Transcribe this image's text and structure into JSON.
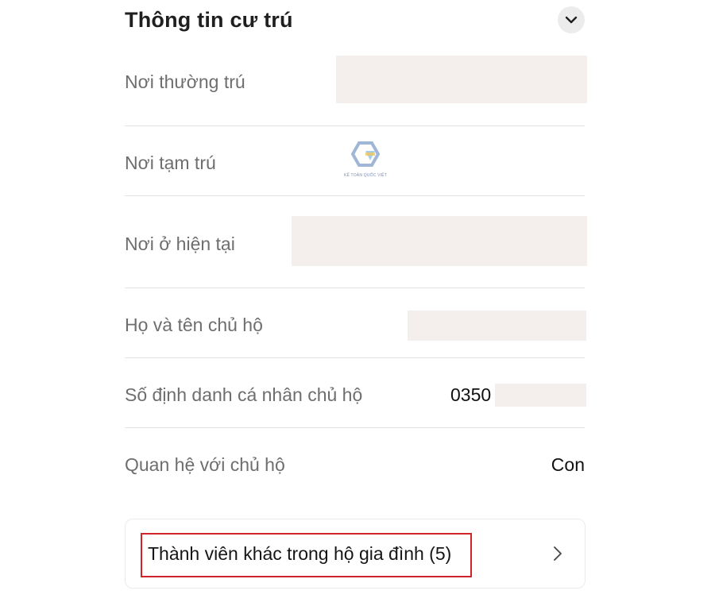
{
  "section": {
    "title": "Thông tin cư trú",
    "toggle_icon": "chevron-down-icon"
  },
  "fields": [
    {
      "label": "Nơi thường trú",
      "value": ""
    },
    {
      "label": "Nơi tạm trú",
      "value": ""
    },
    {
      "label": "Nơi ở hiện tại",
      "value": ""
    },
    {
      "label": "Họ và tên chủ hộ",
      "value": ""
    },
    {
      "label": "Số định danh cá nhân chủ hộ",
      "value": "0350"
    },
    {
      "label": "Quan hệ với chủ hộ",
      "value": "Con"
    }
  ],
  "watermark": {
    "text": "KẾ TOÁN QUỐC VIỆT"
  },
  "members_card": {
    "label": "Thành viên khác trong hộ gia đình (5)",
    "icon": "chevron-right-icon"
  },
  "colors": {
    "highlight_border": "#d2232a",
    "redaction": "#f4efec"
  }
}
